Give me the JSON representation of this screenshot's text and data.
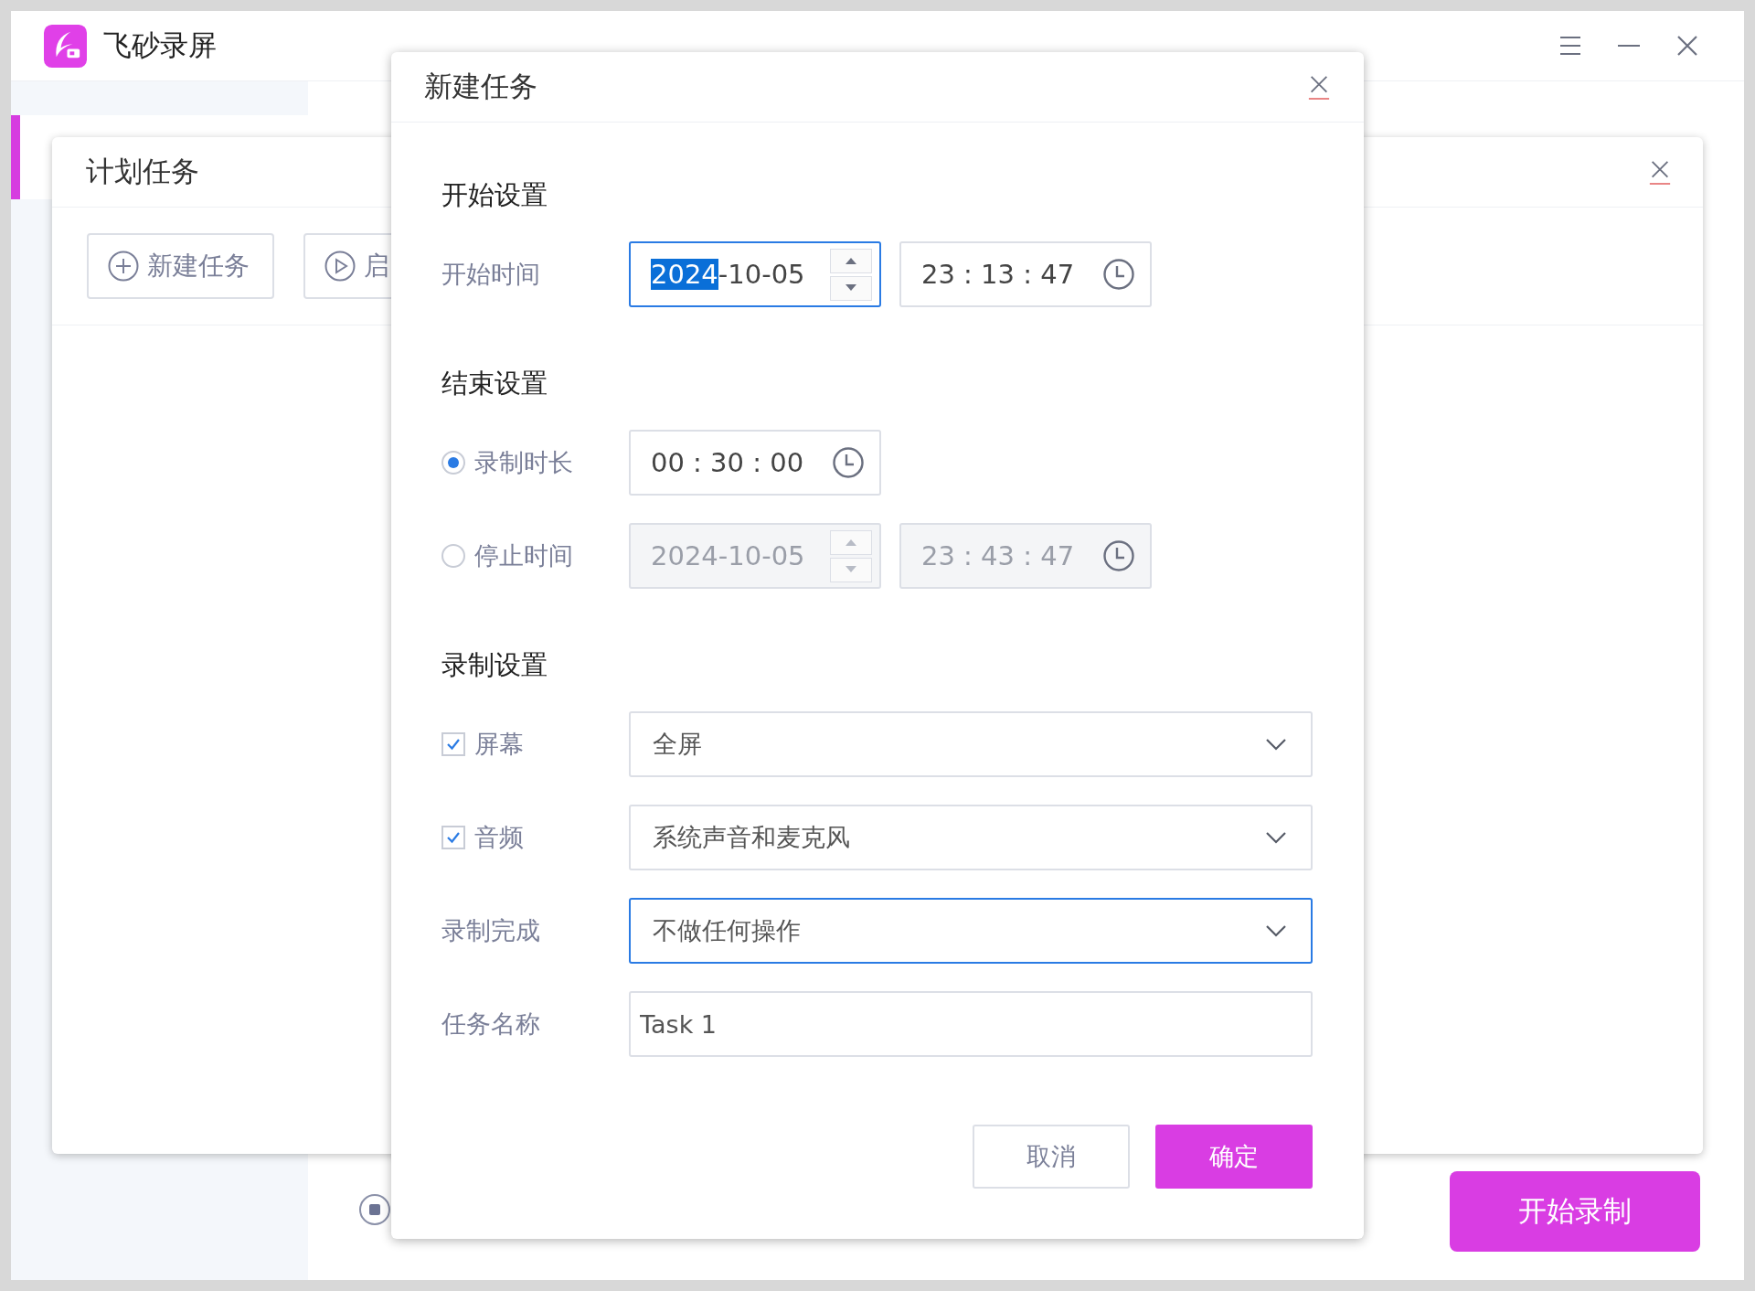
{
  "app": {
    "title": "飞砂录屏",
    "record_button": "开始录制"
  },
  "plan_dialog": {
    "title": "计划任务",
    "toolbar": [
      {
        "label": "新建任务",
        "kind": "new"
      },
      {
        "label": "启",
        "kind": "start"
      }
    ]
  },
  "new_task_dialog": {
    "title": "新建任务",
    "start": {
      "heading": "开始设置",
      "label": "开始时间",
      "date": [
        {
          "text": "2024",
          "selected": true
        },
        {
          "text": "-10-05",
          "selected": false
        }
      ],
      "focused": true,
      "time": "23 : 13 : 47"
    },
    "end": {
      "heading": "结束设置",
      "options": [
        {
          "kind": "duration",
          "label": "录制时长",
          "selected": true,
          "disabled": false,
          "time": "00 : 30 : 00"
        },
        {
          "kind": "stop_time",
          "label": "停止时间",
          "selected": false,
          "disabled": true,
          "date": "2024-10-05",
          "time": "23 : 43 : 47"
        }
      ]
    },
    "record": {
      "heading": "录制设置",
      "rows": [
        {
          "kind": "checkbox_select",
          "label": "屏幕",
          "checked": true,
          "value": "全屏",
          "focused": false
        },
        {
          "kind": "checkbox_select",
          "label": "音频",
          "checked": true,
          "value": "系统声音和麦克风",
          "focused": false
        },
        {
          "kind": "select",
          "label": "录制完成",
          "value": "不做任何操作",
          "focused": true
        },
        {
          "kind": "text",
          "label": "任务名称",
          "value": "Task 1",
          "focused": false
        }
      ]
    },
    "buttons": [
      {
        "kind": "secondary",
        "label": "取消"
      },
      {
        "kind": "primary",
        "label": "确定"
      }
    ]
  }
}
